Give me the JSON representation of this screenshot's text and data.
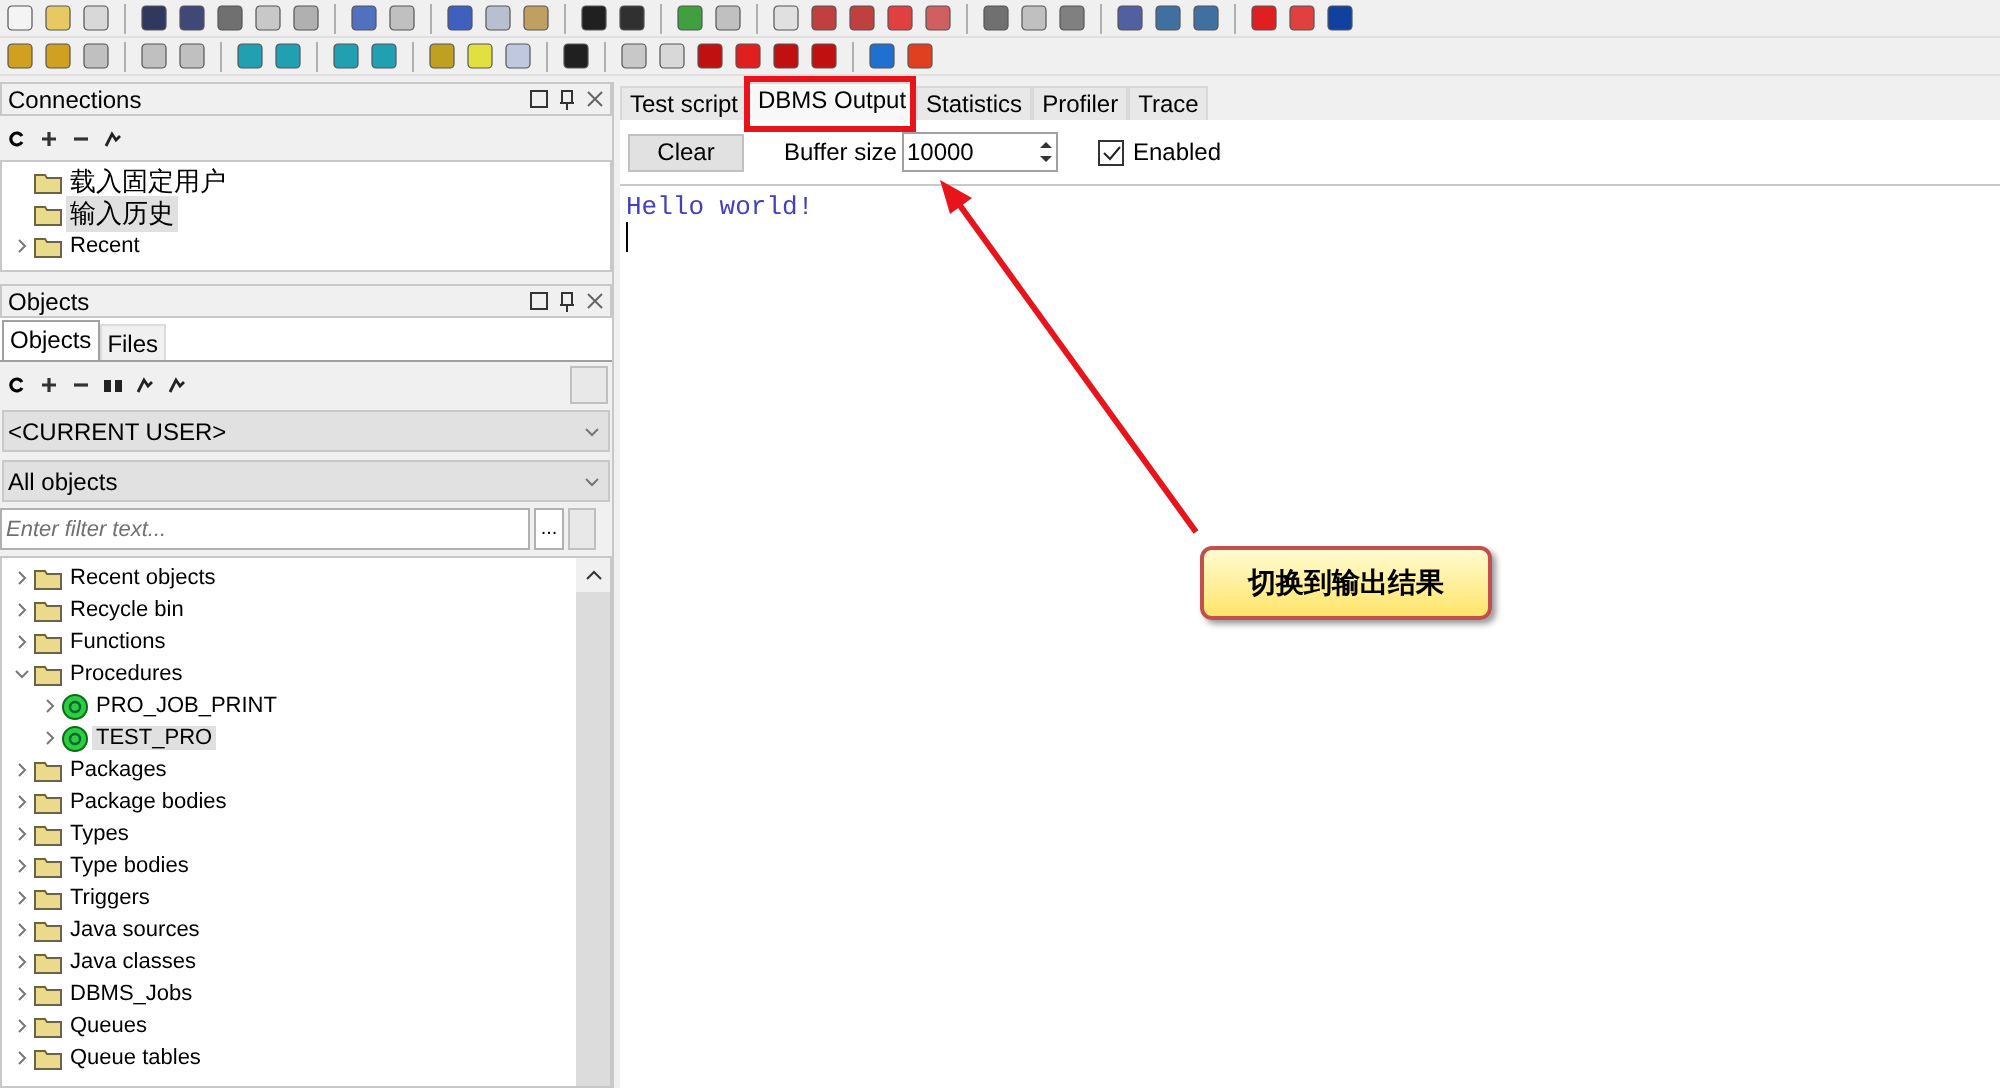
{
  "connections": {
    "title": "Connections",
    "items": [
      {
        "label": "载入固定用户",
        "selected": false,
        "kind": "folder"
      },
      {
        "label": "输入历史",
        "selected": true,
        "kind": "folder"
      },
      {
        "label": "Recent",
        "selected": false,
        "kind": "group"
      }
    ]
  },
  "objects": {
    "title": "Objects",
    "tabs": [
      {
        "label": "Objects",
        "selected": true
      },
      {
        "label": "Files",
        "selected": false
      }
    ],
    "user_select": "<CURRENT USER>",
    "type_select": "All objects",
    "filter": {
      "placeholder": "Enter filter text..."
    },
    "more_button": "...",
    "tree": [
      {
        "label": "Recent objects",
        "kind": "folder",
        "expanded": false,
        "selected": false
      },
      {
        "label": "Recycle bin",
        "kind": "folder",
        "expanded": false,
        "selected": false
      },
      {
        "label": "Functions",
        "kind": "folder",
        "expanded": false,
        "selected": false
      },
      {
        "label": "Procedures",
        "kind": "folder",
        "expanded": true,
        "selected": false,
        "children": [
          {
            "label": "PRO_JOB_PRINT",
            "kind": "procedure",
            "expanded": false,
            "selected": false
          },
          {
            "label": "TEST_PRO",
            "kind": "procedure",
            "expanded": false,
            "selected": true
          }
        ]
      },
      {
        "label": "Packages",
        "kind": "folder",
        "expanded": false,
        "selected": false
      },
      {
        "label": "Package bodies",
        "kind": "folder",
        "expanded": false,
        "selected": false
      },
      {
        "label": "Types",
        "kind": "folder",
        "expanded": false,
        "selected": false
      },
      {
        "label": "Type bodies",
        "kind": "folder",
        "expanded": false,
        "selected": false
      },
      {
        "label": "Triggers",
        "kind": "folder",
        "expanded": false,
        "selected": false
      },
      {
        "label": "Java sources",
        "kind": "folder",
        "expanded": false,
        "selected": false
      },
      {
        "label": "Java classes",
        "kind": "folder",
        "expanded": false,
        "selected": false
      },
      {
        "label": "DBMS_Jobs",
        "kind": "folder",
        "expanded": false,
        "selected": false
      },
      {
        "label": "Queues",
        "kind": "folder",
        "expanded": false,
        "selected": false
      },
      {
        "label": "Queue tables",
        "kind": "folder",
        "expanded": false,
        "selected": false
      }
    ]
  },
  "editor": {
    "tabs": [
      {
        "label": "Test script",
        "selected": false
      },
      {
        "label": "DBMS Output",
        "selected": true
      },
      {
        "label": "Statistics",
        "selected": false
      },
      {
        "label": "Profiler",
        "selected": false
      },
      {
        "label": "Trace",
        "selected": false
      }
    ],
    "clear_button": "Clear",
    "buffer_label": "Buffer size",
    "buffer_value": "10000",
    "enabled": {
      "label": "Enabled",
      "checked": true
    },
    "output": [
      "Hello world!"
    ]
  },
  "annotation": {
    "callout": "切换到输出结果"
  }
}
